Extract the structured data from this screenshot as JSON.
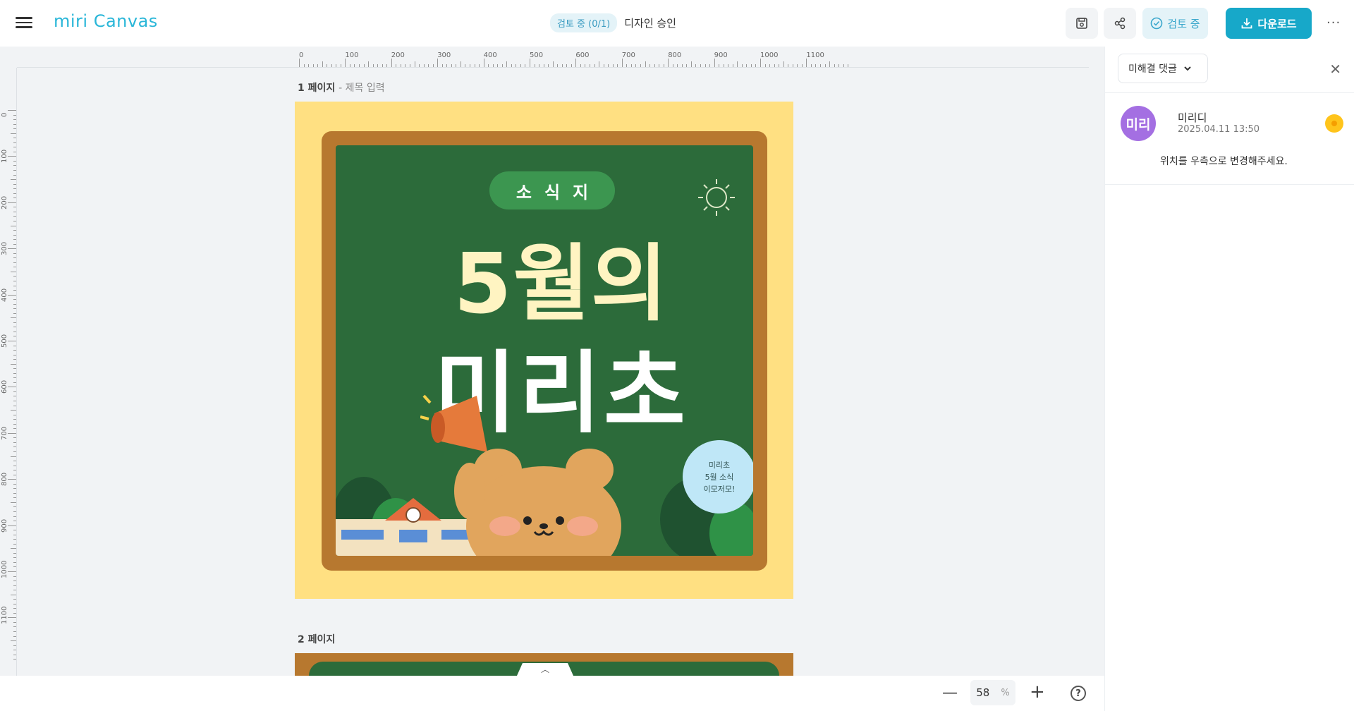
{
  "header": {
    "logo": "miri Canvas",
    "review_status": "검토 중 (0/1)",
    "review_title": "디자인 승인",
    "review_button": "검토 중",
    "download_button": "다운로드"
  },
  "ruler": {
    "top_labels": [
      "0",
      "100",
      "200",
      "300",
      "400",
      "500",
      "600",
      "700",
      "800",
      "900",
      "1000",
      "1100"
    ],
    "left_labels": [
      "0",
      "100",
      "200",
      "300",
      "400",
      "500",
      "600",
      "700",
      "800",
      "900",
      "1000",
      "1100"
    ]
  },
  "canvas": {
    "page1_label": "1 페이지",
    "page1_title_placeholder": "- 제목 입력",
    "page2_label": "2 페이지",
    "design": {
      "pill_chars": [
        "소",
        "식",
        "지"
      ],
      "title_line1": "5월의",
      "title_line2": "미리초",
      "bubble_lines": [
        "미리초",
        "5월 소식",
        "이모저모!"
      ]
    }
  },
  "panel": {
    "filter_label": "미해결 댓글",
    "comment": {
      "avatar_text": "미리",
      "author": "미리디",
      "time": "2025.04.11 13:50",
      "text": "위치를 우측으로 변경해주세요."
    }
  },
  "bottom": {
    "zoom_value": "58",
    "zoom_unit": "%"
  }
}
